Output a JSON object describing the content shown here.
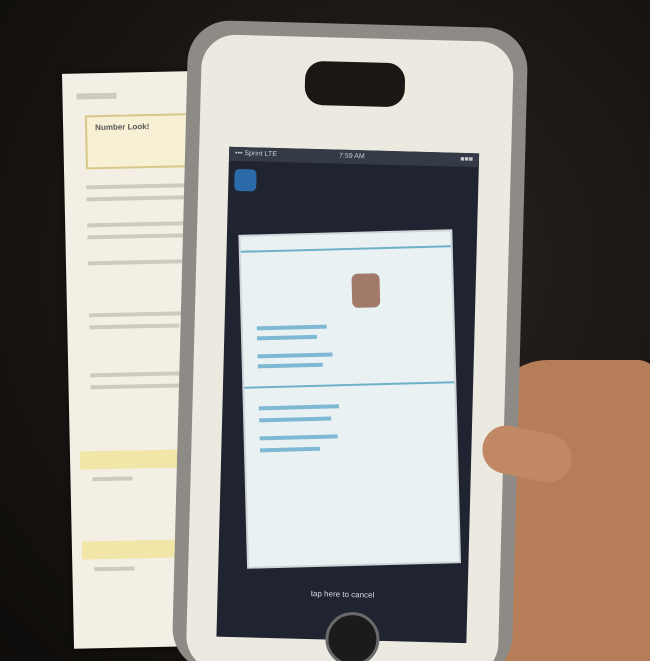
{
  "phone": {
    "status_bar": {
      "carrier": "••• Sprint LTE",
      "time": "7:59 AM",
      "battery": "■■■"
    },
    "cancel_hint": "tap here to cancel"
  },
  "paper": {
    "box_title": "Number Look!"
  },
  "colors": {
    "phone_case": "#8e8a85",
    "case_inner": "#ece9e0",
    "screen_bg": "#1f2430",
    "paper": "#f3efe4"
  }
}
